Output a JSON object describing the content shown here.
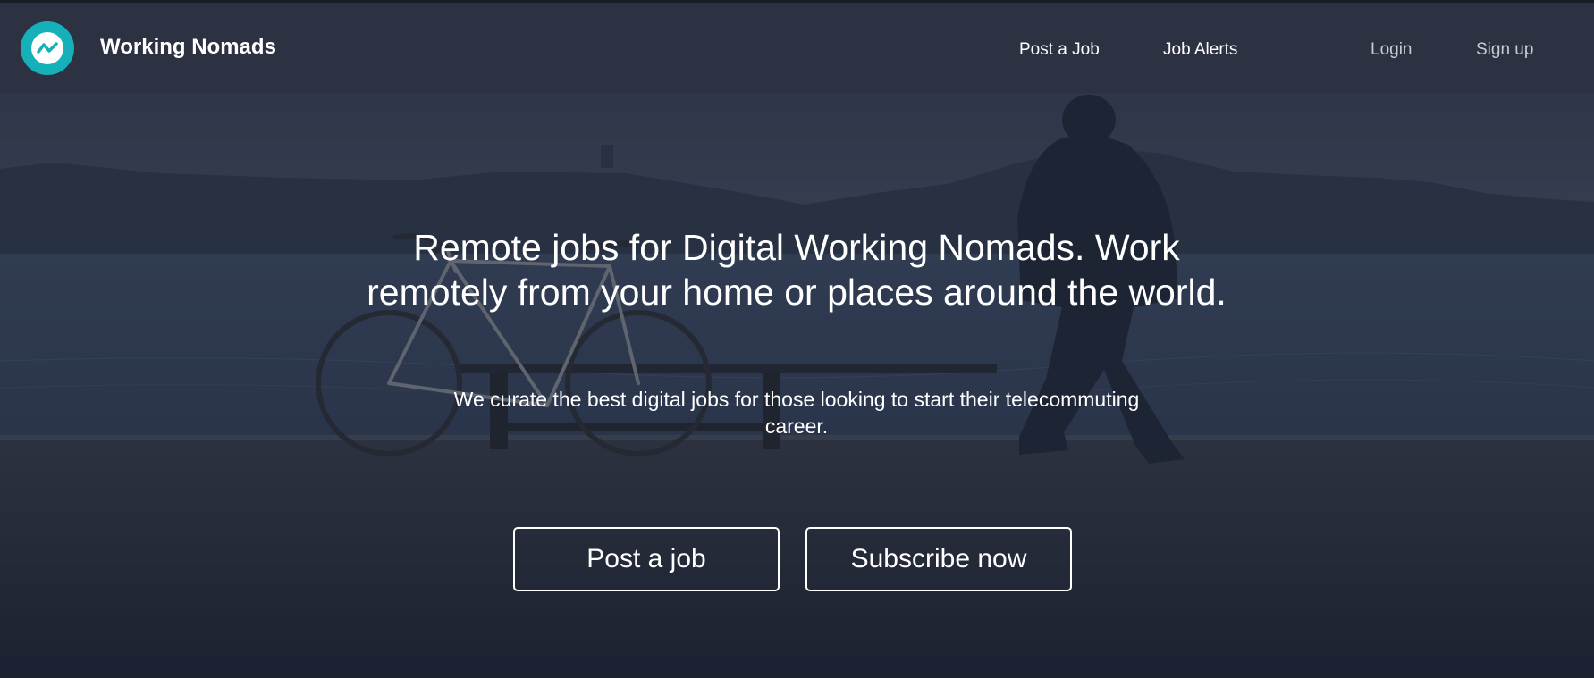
{
  "header": {
    "brand": "Working Nomads",
    "nav": {
      "post_job": "Post a Job",
      "job_alerts": "Job Alerts",
      "login": "Login",
      "signup": "Sign up"
    }
  },
  "hero": {
    "headline": "Remote jobs for Digital Working Nomads. Work remotely from your home or places around the world.",
    "subheadline": "We curate the best digital jobs for those looking to start their telecommuting career.",
    "buttons": {
      "post_job": "Post a job",
      "subscribe": "Subscribe now"
    }
  },
  "colors": {
    "navbar": "#2d3242",
    "logo_accent": "#16b0b8",
    "hero_overlay": "#1f2636",
    "text": "#ffffff"
  }
}
